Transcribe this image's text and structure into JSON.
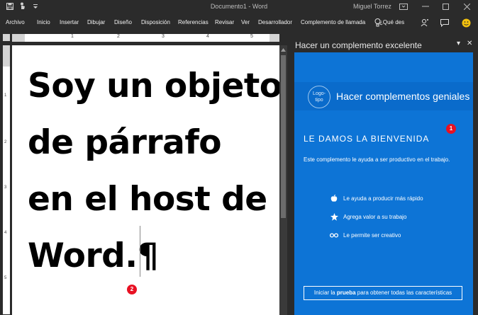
{
  "window": {
    "title": "Documento1 - Word",
    "user": "Miguel Torrez"
  },
  "ribbon": {
    "tabs": [
      "Archivo",
      "Inicio",
      "Insertar",
      "Dibujar",
      "Diseño",
      "Disposición",
      "Referencias",
      "Revisar",
      "Ver",
      "Desarrollador",
      "Complemento de llamada"
    ],
    "tell_me": "¿Qué des"
  },
  "ruler": {
    "h_numbers": [
      "1",
      "2",
      "3",
      "4",
      "5"
    ],
    "v_numbers": [
      "1",
      "2",
      "3",
      "4",
      "5"
    ]
  },
  "document": {
    "lines": [
      "Soy un objeto",
      "de párrafo",
      "en el host de",
      "Word.¶"
    ]
  },
  "badges": {
    "doc_badge": "2",
    "pane_badge": "1"
  },
  "task_pane": {
    "header_title": "Hacer un complemento excelente",
    "logo_text": "Logo-\ntipo",
    "band_title": "Hacer complementos geniales",
    "welcome": "LE DAMOS LA BIENVENIDA",
    "intro": "Este complemento le ayuda a ser productivo en el trabajo.",
    "features": [
      {
        "icon": "apple-icon",
        "text": "Le ayuda a producir más rápido"
      },
      {
        "icon": "star-icon",
        "text": "Agrega valor a su trabajo"
      },
      {
        "icon": "infinity-icon",
        "text": "Le permite ser creativo"
      }
    ],
    "cta_prefix": "Iniciar la ",
    "cta_bold": "prueba",
    "cta_suffix": " para obtener todas las características"
  },
  "colors": {
    "pane_blue": "#0d74d6",
    "chrome_dark": "#2b2b2b",
    "badge_red": "#e81123"
  }
}
